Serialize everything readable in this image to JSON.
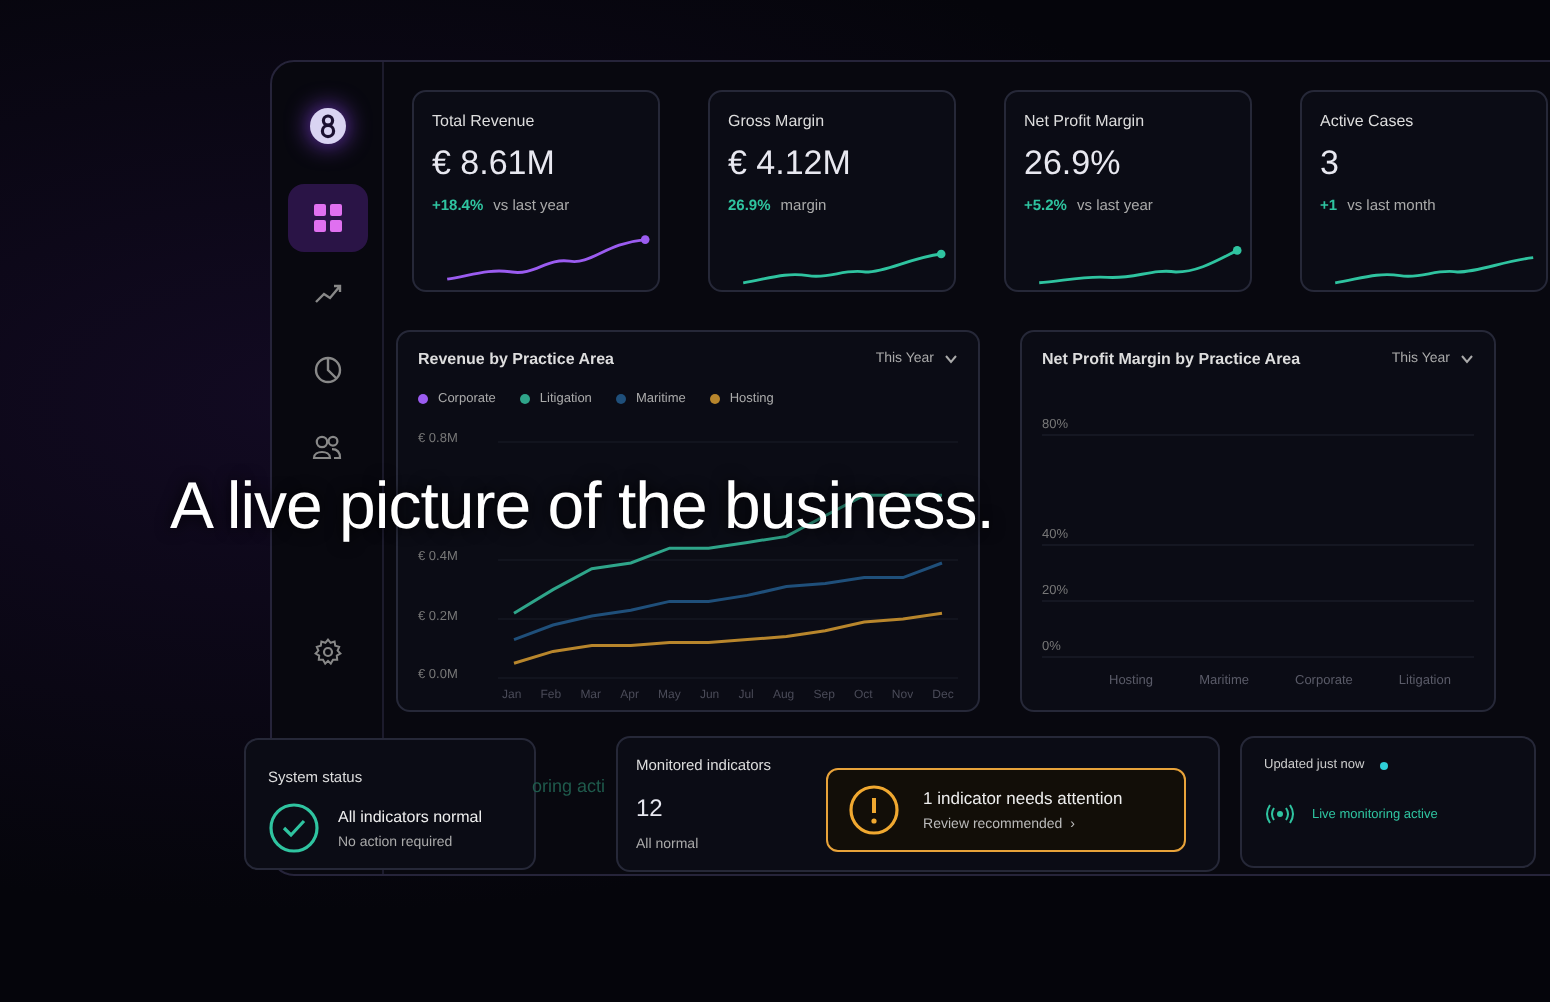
{
  "headline": "A live picture of the business.",
  "nav": [
    {
      "kind": "grid",
      "selected": true
    },
    {
      "kind": "trend",
      "selected": false
    },
    {
      "kind": "clock",
      "selected": false
    },
    {
      "kind": "people",
      "selected": false
    },
    {
      "kind": "gear",
      "selected": false
    }
  ],
  "kpis": [
    {
      "title": "Total Revenue",
      "value": "€ 8.61M",
      "delta": "+18.4%",
      "note": "vs last year",
      "color": "#9b5cf0"
    },
    {
      "title": "Gross Margin",
      "value": "€ 4.12M",
      "delta": "26.9%",
      "note": "margin",
      "color": "#2fc4a0"
    },
    {
      "title": "Net Profit Margin",
      "value": "26.9%",
      "delta": "+5.2%",
      "note": "vs last year",
      "color": "#2fc4a0"
    },
    {
      "title": "Active Cases",
      "value": "3",
      "delta": "+1",
      "note": "vs last month",
      "color": "#2fc4a0"
    }
  ],
  "revenue_chart": {
    "title": "Revenue by Practice Area",
    "period": "This Year",
    "chart_data": {
      "type": "line",
      "x": [
        "Jan",
        "Feb",
        "Mar",
        "Apr",
        "May",
        "Jun",
        "Jul",
        "Aug",
        "Sep",
        "Oct",
        "Nov",
        "Dec"
      ],
      "ylim": [
        0,
        0.8
      ],
      "yticks": [
        {
          "value": 0,
          "label": "€ 0.0M"
        },
        {
          "value": 0.2,
          "label": "€ 0.2M"
        },
        {
          "value": 0.4,
          "label": "€ 0.4M"
        },
        {
          "value": 0.8,
          "label": "€ 0.8M"
        }
      ],
      "series": [
        {
          "name": "Corporate",
          "color": "#9b5cf0",
          "values": [
            null,
            null,
            null,
            null,
            null,
            null,
            null,
            null,
            null,
            null,
            null,
            null
          ]
        },
        {
          "name": "Litigation",
          "color": "#2fa58a",
          "values": [
            0.22,
            0.3,
            0.37,
            0.39,
            0.44,
            0.44,
            0.46,
            0.48,
            0.55,
            0.62,
            0.62,
            0.62
          ]
        },
        {
          "name": "Maritime",
          "color": "#1f4f7a",
          "values": [
            0.13,
            0.18,
            0.21,
            0.23,
            0.26,
            0.26,
            0.28,
            0.31,
            0.32,
            0.34,
            0.34,
            0.39
          ]
        },
        {
          "name": "Hosting",
          "color": "#b8862c",
          "values": [
            0.05,
            0.09,
            0.11,
            0.11,
            0.12,
            0.12,
            0.13,
            0.14,
            0.16,
            0.19,
            0.2,
            0.22
          ]
        }
      ]
    }
  },
  "margin_chart": {
    "title": "Net Profit Margin by Practice Area",
    "period": "This Year",
    "y_labels": [
      "80%",
      "40%",
      "20%",
      "0%"
    ],
    "x_labels": [
      "Hosting",
      "Maritime",
      "Corporate",
      "Litigation"
    ]
  },
  "system_status": {
    "title": "System status",
    "message": "All indicators normal",
    "detail": "No action required"
  },
  "faded_text": "oring acti",
  "monitored": {
    "title": "Monitored indicators",
    "count": "12",
    "note": "All normal",
    "alert_title": "1 indicator needs attention",
    "alert_action": "Review recommended",
    "alert_chevron": "›"
  },
  "live": {
    "updated": "Updated just now",
    "status": "Live monitoring active"
  }
}
